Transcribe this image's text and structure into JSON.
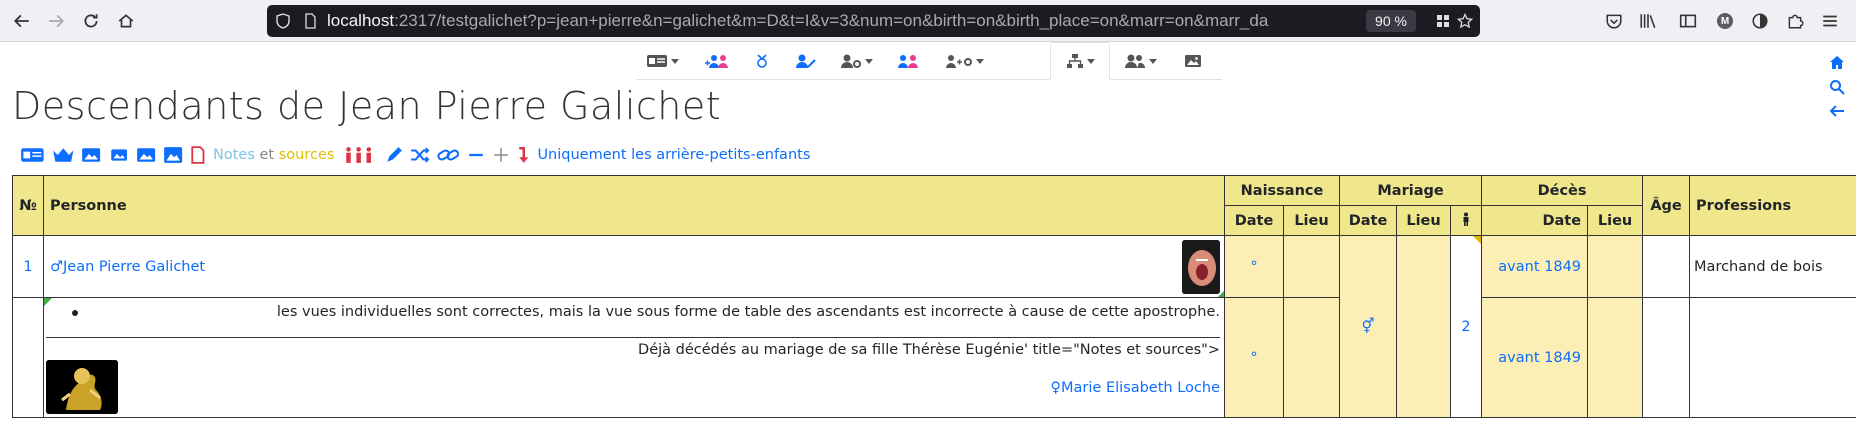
{
  "browser": {
    "url_host": "localhost",
    "url_rest": ":2317/testgalichet?p=jean+pierre&n=galichet&m=D&t=I&v=3&num=on&birth=on&birth_place=on&marr=on&marr_da",
    "zoom": "90 %",
    "profile_initial": "M"
  },
  "page": {
    "title": "Descendants de Jean Pierre Galichet"
  },
  "toolbar": {
    "notes_word": "Notes",
    "et_word": " et ",
    "sources_word": "sources",
    "only_label": "Uniquement les arrière-petits-enfants"
  },
  "table": {
    "headers": {
      "num": "№",
      "person": "Personne",
      "birth": "Naissance",
      "marriage": "Mariage",
      "death": "Décès",
      "age": "Âge",
      "professions": "Professions",
      "date": "Date",
      "place": "Lieu"
    },
    "rows": [
      {
        "num": "1",
        "name": "Jean Pierre Galichet",
        "sex_symbol": "♂",
        "birth_date": "°",
        "death_date": "avant 1849",
        "profession": "Marchand de bois"
      }
    ],
    "note_row": {
      "note_text": "les vues individuelles sont correctes, mais la vue sous forme de table des ascendants est incorrecte à cause de cette apostrophe.",
      "note_text2": "Déjà décédés au mariage de sa fille Thérèse Eugénie' title=\"Notes et sources\">",
      "spouse_symbol": "♀",
      "spouse_name": "Marie Elisabeth Loche",
      "spouse_birth_date": "°",
      "spouse_death_date": "avant 1849",
      "marriage_symbol": "⚥",
      "children_count": "2"
    }
  },
  "colors": {
    "header_bg": "#f0e68c",
    "cell_bg": "#fcefb5",
    "link": "#0d6efd",
    "female": "#e83e8c"
  }
}
